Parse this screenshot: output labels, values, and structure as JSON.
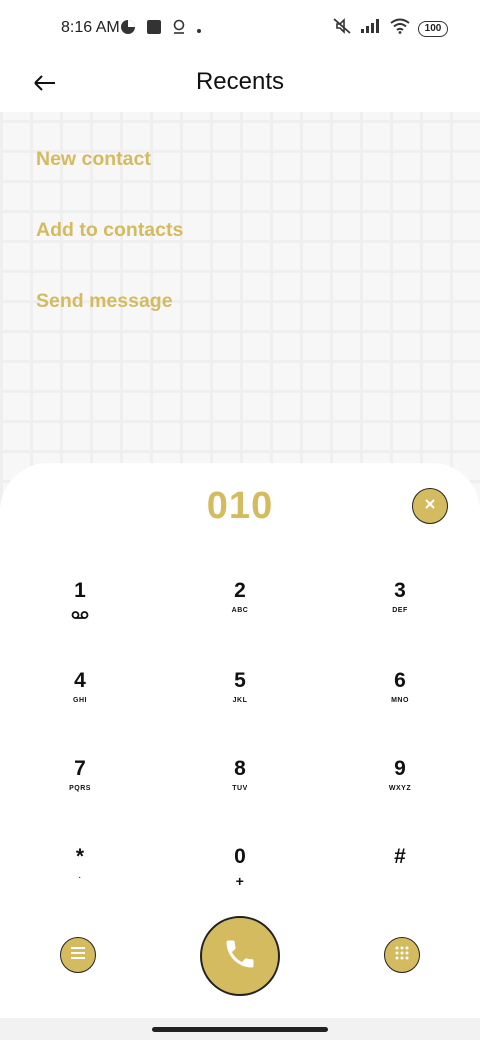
{
  "status_bar": {
    "time": "8:16 AM",
    "battery": "100",
    "left_icons": [
      "vpn-icon",
      "stop-icon",
      "location-icon",
      "dot-icon"
    ],
    "right_icons": [
      "mute-icon",
      "signal-icon",
      "wifi-icon",
      "battery-icon"
    ]
  },
  "header": {
    "title": "Recents",
    "back_icon": "arrow-left-icon"
  },
  "menu": {
    "items": [
      {
        "label": "New contact"
      },
      {
        "label": "Add to contacts"
      },
      {
        "label": "Send message"
      }
    ]
  },
  "dialpad": {
    "number": "010",
    "keys": [
      {
        "digit": "1",
        "letters": ""
      },
      {
        "digit": "2",
        "letters": "ABC"
      },
      {
        "digit": "3",
        "letters": "DEF"
      },
      {
        "digit": "4",
        "letters": "GHI"
      },
      {
        "digit": "5",
        "letters": "JKL"
      },
      {
        "digit": "6",
        "letters": "MNO"
      },
      {
        "digit": "7",
        "letters": "PQRS"
      },
      {
        "digit": "8",
        "letters": "TUV"
      },
      {
        "digit": "9",
        "letters": "WXYZ"
      },
      {
        "digit": "*",
        "letters": "."
      },
      {
        "digit": "0",
        "letters": "+"
      },
      {
        "digit": "#",
        "letters": ""
      }
    ]
  },
  "colors": {
    "accent": "#d4bb5f",
    "text": "#111111",
    "background": "#f7f7f7"
  }
}
